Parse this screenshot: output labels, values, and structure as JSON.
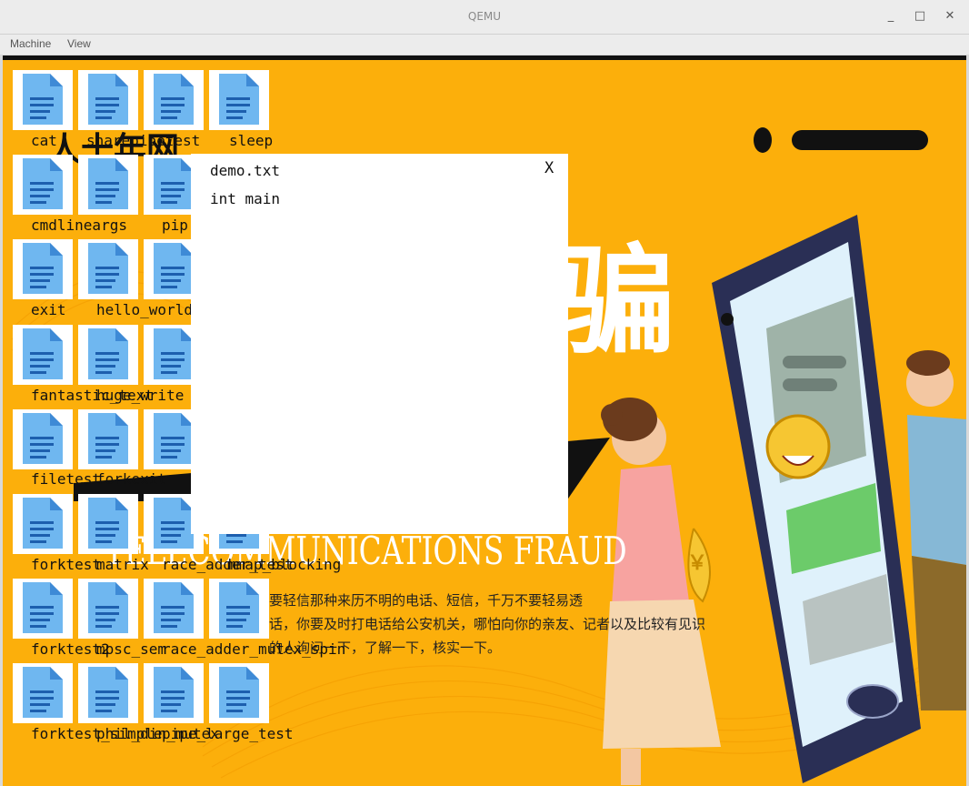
{
  "window": {
    "title": "QEMU",
    "minimize": "_",
    "maximize": "□",
    "close": "✕"
  },
  "menu": [
    "Machine",
    "View"
  ],
  "wallpaper": {
    "heading_cn": "骗",
    "heading_en": "TELECOMMUNICATIONS FRAUD",
    "line1": "要轻信那种来历不明的电话、短信，千万不要轻易透",
    "line2": "话，你要及时打电话给公安机关，哪怕向你的亲友、记者以及比较有见识",
    "line3": "的人询问一下，了解一下，核实一下。",
    "bag": "￥",
    "colors": {
      "background": "#fcaf0b",
      "phone": "#2a2f55"
    }
  },
  "desktop": {
    "labels": [
      "cat",
      "sharepipetest",
      "sleep",
      "cmdlineargs",
      "pip",
      "exit",
      "hello_world",
      "fantastic_text",
      "huge_write",
      "filetest",
      "forkexit",
      "forktest",
      "matrix",
      "race_adder_test",
      "mmap_blocking",
      "forktest2",
      "mpsc_sem",
      "race_adder_mutex_spin",
      "forktest_simple",
      "phil_din_mutex",
      "pipe_large_test"
    ]
  },
  "dialog": {
    "title": "demo.txt",
    "close": "X",
    "content": "int main"
  }
}
